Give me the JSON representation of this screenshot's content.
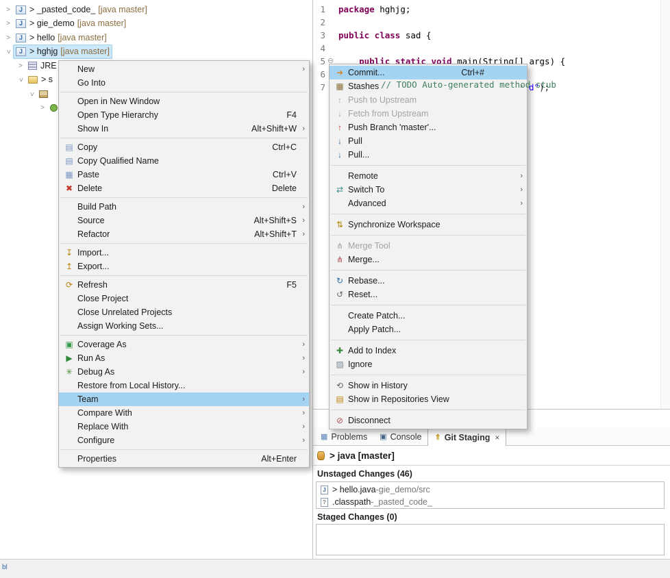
{
  "icons": {
    "chevron": ">",
    "submenu_arrow": "›",
    "project_letter": "J",
    "java_file_letter": "J",
    "unknown_file_mark": "?",
    "copy": "▤",
    "copy_qualified": "▤",
    "paste": "▦",
    "delete": "✖",
    "import": "↧",
    "export": "↥",
    "refresh": "⟳",
    "coverage": "▣",
    "run": "▶",
    "debug": "✳",
    "commit": "➜",
    "stashes": "▦",
    "push": "↑",
    "fetch": "↓",
    "push_branch": "↑",
    "pull": "↓",
    "switch_to": "⇄",
    "sync": "⇅",
    "merge_tool": "⋔",
    "merge": "⋔",
    "rebase": "↻",
    "reset": "↺",
    "add_to_index": "✚",
    "ignore": "▨",
    "history": "⟲",
    "repositories": "▤",
    "disconnect": "⊘",
    "problems_tab": "▦",
    "console_tab": "▣",
    "git_staging_tab": "⇑",
    "close_tab": "×"
  },
  "package_explorer": {
    "projects": [
      {
        "dirty": "> ",
        "name": "_pasted_code_",
        "decoration": "[java master]"
      },
      {
        "dirty": "> ",
        "name": "gie_demo",
        "decoration": "[java master]"
      },
      {
        "dirty": "> ",
        "name": "hello",
        "decoration": "[java master]"
      },
      {
        "dirty": "> ",
        "name": "hghjg",
        "decoration": "[java master]"
      },
      {
        "dirty": "",
        "name": "JRE",
        "decoration": ""
      },
      {
        "dirty": "> ",
        "name": "s",
        "decoration": ""
      }
    ]
  },
  "editor": {
    "lines": [
      {
        "num": "1",
        "kw": "package",
        "plain": " hghjg;"
      },
      {
        "num": "2"
      },
      {
        "num": "3",
        "kw": "public class",
        "plain": " sad {"
      },
      {
        "num": "4"
      },
      {
        "num": "5",
        "fold": "⊖",
        "indent": "    ",
        "kw": "public static void",
        "plain": " main(String[] args) {"
      },
      {
        "num": "6"
      },
      {
        "num": "7"
      }
    ],
    "glitch_comment": "// TODO Auto-generated method stub",
    "line7_visible_string": "d\"",
    "line7_visible_plain": ");"
  },
  "context_menu": {
    "new": {
      "label": "New"
    },
    "go_into": {
      "label": "Go Into"
    },
    "open_in_new_window": {
      "label": "Open in New Window"
    },
    "open_type_hierarchy": {
      "label": "Open Type Hierarchy",
      "shortcut": "F4"
    },
    "show_in": {
      "label": "Show In",
      "shortcut": "Alt+Shift+W"
    },
    "copy": {
      "label": "Copy",
      "shortcut": "Ctrl+C"
    },
    "copy_qualified_name": {
      "label": "Copy Qualified Name"
    },
    "paste": {
      "label": "Paste",
      "shortcut": "Ctrl+V"
    },
    "delete": {
      "label": "Delete",
      "shortcut": "Delete"
    },
    "build_path": {
      "label": "Build Path"
    },
    "source": {
      "label": "Source",
      "shortcut": "Alt+Shift+S"
    },
    "refactor": {
      "label": "Refactor",
      "shortcut": "Alt+Shift+T"
    },
    "import": {
      "label": "Import..."
    },
    "export": {
      "label": "Export..."
    },
    "refresh": {
      "label": "Refresh",
      "shortcut": "F5"
    },
    "close_project": {
      "label": "Close Project"
    },
    "close_unrelated_projects": {
      "label": "Close Unrelated Projects"
    },
    "assign_working_sets": {
      "label": "Assign Working Sets..."
    },
    "coverage_as": {
      "label": "Coverage As"
    },
    "run_as": {
      "label": "Run As"
    },
    "debug_as": {
      "label": "Debug As"
    },
    "restore_from_local_history": {
      "label": "Restore from Local History..."
    },
    "team": {
      "label": "Team"
    },
    "compare_with": {
      "label": "Compare With"
    },
    "replace_with": {
      "label": "Replace With"
    },
    "configure": {
      "label": "Configure"
    },
    "properties": {
      "label": "Properties",
      "shortcut": "Alt+Enter"
    }
  },
  "team_menu": {
    "commit": {
      "label": "Commit...",
      "shortcut": "Ctrl+#"
    },
    "stashes": {
      "label": "Stashes"
    },
    "push_to_upstream": {
      "label": "Push to Upstream"
    },
    "fetch_from_upstream": {
      "label": "Fetch from Upstream"
    },
    "push_branch": {
      "label": "Push Branch 'master'..."
    },
    "pull": {
      "label": "Pull"
    },
    "pull_ellipsis": {
      "label": "Pull..."
    },
    "remote": {
      "label": "Remote"
    },
    "switch_to": {
      "label": "Switch To"
    },
    "advanced": {
      "label": "Advanced"
    },
    "synchronize_workspace": {
      "label": "Synchronize Workspace"
    },
    "merge_tool": {
      "label": "Merge Tool"
    },
    "merge": {
      "label": "Merge..."
    },
    "rebase": {
      "label": "Rebase..."
    },
    "reset": {
      "label": "Reset..."
    },
    "create_patch": {
      "label": "Create Patch..."
    },
    "apply_patch": {
      "label": "Apply Patch..."
    },
    "add_to_index": {
      "label": "Add to Index"
    },
    "ignore": {
      "label": "Ignore"
    },
    "show_in_history": {
      "label": "Show in History"
    },
    "show_in_repositories_view": {
      "label": "Show in Repositories View"
    },
    "disconnect": {
      "label": "Disconnect"
    }
  },
  "bottom_panel": {
    "tabs": {
      "problems": "Problems",
      "console": "Console",
      "git_staging": "Git Staging"
    },
    "repo_label": "> java [master]",
    "unstaged_header": "Unstaged Changes (46)",
    "staged_header": "Staged Changes (0)",
    "list_separator": " - ",
    "unstaged_items": [
      {
        "name": "> hello.java",
        "path": "gie_demo/src"
      },
      {
        "name": ".classpath",
        "path": "_pasted_code_"
      }
    ]
  },
  "status_bar": {
    "fragment": "bl"
  }
}
